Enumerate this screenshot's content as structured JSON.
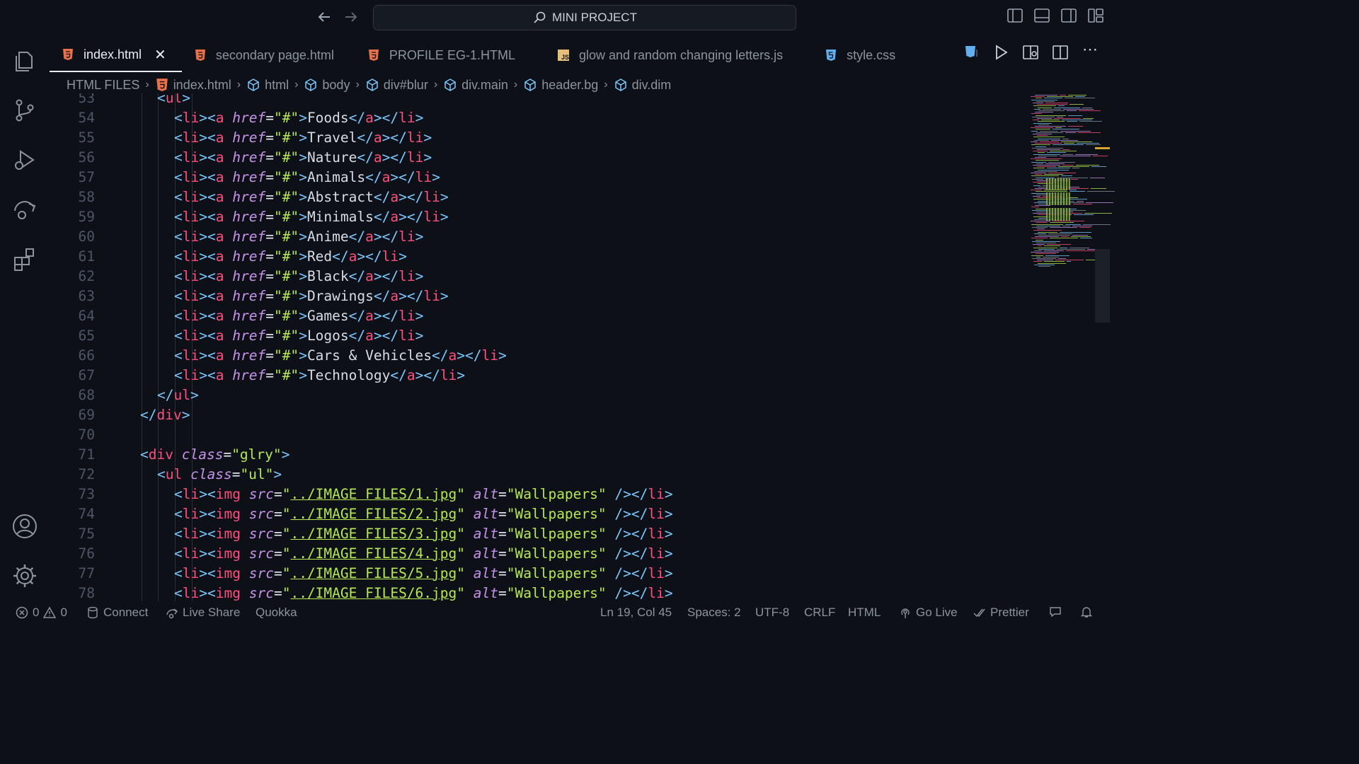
{
  "titlebar": {
    "back_icon": "arrow-left-icon",
    "forward_icon": "arrow-right-icon",
    "search_text": "MINI PROJECT"
  },
  "tabs": [
    {
      "label": "index.html",
      "icon": "html-file-icon",
      "active": true
    },
    {
      "label": "secondary page.html",
      "icon": "html-file-icon"
    },
    {
      "label": "PROFILE EG-1.HTML",
      "icon": "html-file-icon"
    },
    {
      "label": "glow and random changing letters.js",
      "icon": "js-file-icon",
      "badge": "JS"
    },
    {
      "label": "style.css",
      "icon": "css-file-icon"
    }
  ],
  "breadcrumb": {
    "folder": "HTML FILES",
    "items": [
      "index.html",
      "html",
      "body",
      "div#blur",
      "div.main",
      "header.bg",
      "div.dim"
    ]
  },
  "editor": {
    "line_numbers": [
      "53",
      "54",
      "55",
      "56",
      "57",
      "58",
      "59",
      "60",
      "61",
      "62",
      "63",
      "64",
      "65",
      "66",
      "67",
      "68",
      "69",
      "70",
      "71",
      "72",
      "73",
      "74",
      "75",
      "76",
      "77",
      "78"
    ],
    "menu_items": [
      "Foods",
      "Travel",
      "Nature",
      "Animals",
      "Abstract",
      "Minimals",
      "Anime",
      "Red",
      "Black",
      "Drawings",
      "Games",
      "Logos",
      "Cars & Vehicles",
      "Technology"
    ],
    "href_value": "\"#\"",
    "ul_open": "<ul>",
    "ul_close": "</ul>",
    "div_close": "</div>",
    "div_class": "\"glry\"",
    "ul_class": "\"ul\"",
    "img_sources": [
      "../IMAGE FILES/1.jpg",
      "../IMAGE FILES/2.jpg",
      "../IMAGE FILES/3.jpg",
      "../IMAGE FILES/4.jpg",
      "../IMAGE FILES/5.jpg",
      "../IMAGE FILES/6.jpg"
    ],
    "img_alt": "\"Wallpapers\""
  },
  "statusbar": {
    "errors": "0",
    "warnings": "0",
    "connect": "Connect",
    "live_share": "Live Share",
    "quokka": "Quokka",
    "position": "Ln 19, Col 45",
    "spaces": "Spaces: 2",
    "encoding": "UTF-8",
    "eol": "CRLF",
    "language": "HTML",
    "go_live": "Go Live",
    "prettier": "Prettier"
  },
  "colors": {
    "background": "#0d1117",
    "tag": "#ff4f7e",
    "bracket": "#7cc6ff",
    "attribute": "#c792ea",
    "string": "#b5e853",
    "html_icon": "#e8704a",
    "js_badge": "#e5c07b",
    "css_icon": "#61afef"
  }
}
